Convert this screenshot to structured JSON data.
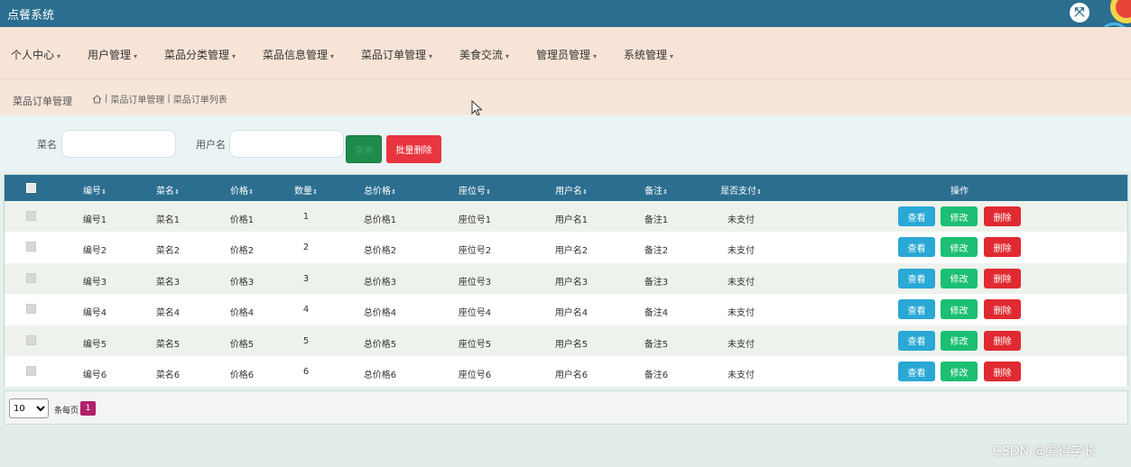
{
  "app": {
    "title": "点餐系统"
  },
  "nav": {
    "items": [
      {
        "label": "个人中心"
      },
      {
        "label": "用户管理"
      },
      {
        "label": "菜品分类管理"
      },
      {
        "label": "菜品信息管理"
      },
      {
        "label": "菜品订单管理"
      },
      {
        "label": "美食交流"
      },
      {
        "label": "管理员管理"
      },
      {
        "label": "系统管理"
      }
    ]
  },
  "breadcrumb": {
    "section_title": "菜品订单管理",
    "sep": "|",
    "path1": "菜品订单管理",
    "path2": "菜品订单列表"
  },
  "search": {
    "dish_label": "菜名",
    "dish_value": "",
    "user_label": "用户名",
    "user_value": "",
    "search_label": "查询",
    "batch_delete_label": "批量删除"
  },
  "table": {
    "columns": [
      "编号",
      "菜名",
      "价格",
      "数量",
      "总价格",
      "座位号",
      "用户名",
      "备注",
      "是否支付",
      "操作"
    ],
    "sort_glyph": "⇕",
    "rows": [
      {
        "id": "编号1",
        "dish": "菜名1",
        "price": "价格1",
        "qty": "1",
        "total": "总价格1",
        "seat": "座位号1",
        "user": "用户名1",
        "note": "备注1",
        "paid": "未支付"
      },
      {
        "id": "编号2",
        "dish": "菜名2",
        "price": "价格2",
        "qty": "2",
        "total": "总价格2",
        "seat": "座位号2",
        "user": "用户名2",
        "note": "备注2",
        "paid": "未支付"
      },
      {
        "id": "编号3",
        "dish": "菜名3",
        "price": "价格3",
        "qty": "3",
        "total": "总价格3",
        "seat": "座位号3",
        "user": "用户名3",
        "note": "备注3",
        "paid": "未支付"
      },
      {
        "id": "编号4",
        "dish": "菜名4",
        "price": "价格4",
        "qty": "4",
        "total": "总价格4",
        "seat": "座位号4",
        "user": "用户名4",
        "note": "备注4",
        "paid": "未支付"
      },
      {
        "id": "编号5",
        "dish": "菜名5",
        "price": "价格5",
        "qty": "5",
        "total": "总价格5",
        "seat": "座位号5",
        "user": "用户名5",
        "note": "备注5",
        "paid": "未支付"
      },
      {
        "id": "编号6",
        "dish": "菜名6",
        "price": "价格6",
        "qty": "6",
        "total": "总价格6",
        "seat": "座位号6",
        "user": "用户名6",
        "note": "备注6",
        "paid": "未支付"
      }
    ],
    "actions": {
      "view": "查看",
      "edit": "修改",
      "delete": "删除"
    }
  },
  "pager": {
    "page_size": "10",
    "per_page_label": "条每页",
    "current_page": "1"
  },
  "watermark": "CSDN @爱得学长",
  "colors": {
    "header": "#2b6e8f",
    "nav_bg": "#f8e4d6",
    "view_btn": "#2aa8d6",
    "edit_btn": "#1cbf73",
    "delete_btn": "#e02a31",
    "page_active": "#b0206c"
  }
}
